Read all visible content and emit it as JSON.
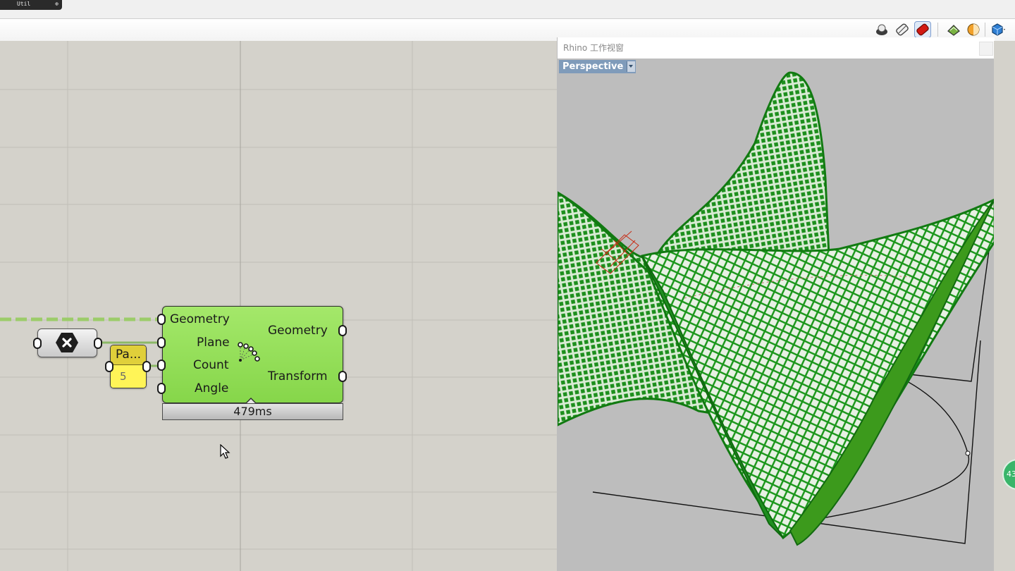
{
  "top_tab": {
    "label": "Util",
    "pin": "⊕"
  },
  "toolbar": {
    "icons": [
      "viewport-shade-icon",
      "wireframe-preview-icon",
      "shaded-preview-icon",
      "bake-icon",
      "material-ball-icon",
      "display-mode-icon"
    ]
  },
  "canvas": {
    "cull_component": {
      "icon": "cross-hex-icon"
    },
    "param": {
      "title": "Pa...",
      "value": "5"
    },
    "orient_component": {
      "inputs": [
        "Geometry",
        "Plane",
        "Count",
        "Angle"
      ],
      "outputs": [
        "Geometry",
        "Transform"
      ],
      "timer": "479ms",
      "accent": "#8fdb50"
    }
  },
  "rhino_window": {
    "title": "Rhino 工作视窗",
    "viewport_label": "Perspective",
    "mesh_color": "#16a016"
  },
  "badge": {
    "text": "43"
  }
}
